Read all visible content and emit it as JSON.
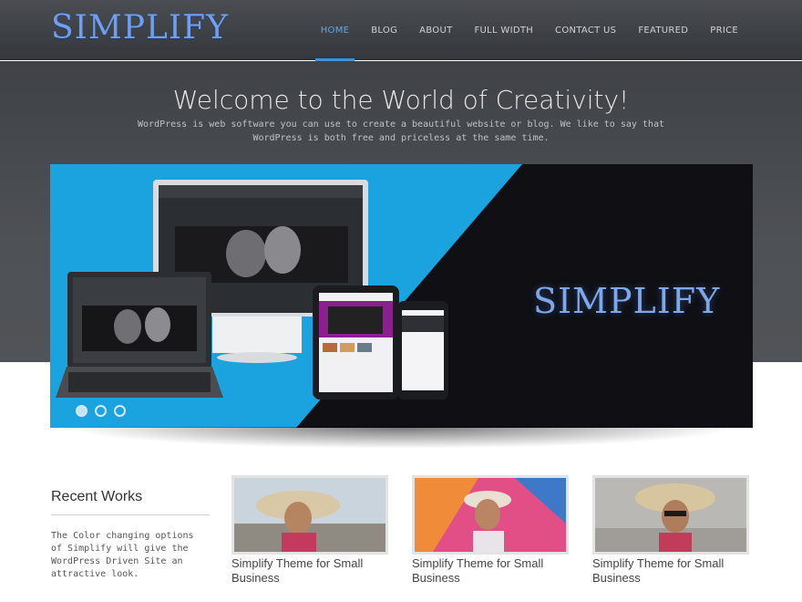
{
  "header": {
    "logo": "SIMPLIFY",
    "nav": [
      "HOME",
      "BLOG",
      "ABOUT",
      "FULL WIDTH",
      "CONTACT US",
      "FEATURED",
      "PRICE"
    ],
    "active_nav": "HOME"
  },
  "hero": {
    "title": "Welcome to the World of Creativity!",
    "subtitle": "WordPress is web software you can use to create a beautiful website or blog. We like to say that WordPress is both free and priceless at the same time."
  },
  "slider": {
    "slide_logo": "SIMPLIFY",
    "dots": 3,
    "active_dot": 1
  },
  "recent_works": {
    "title": "Recent Works",
    "description": "The Color changing options of Simplify will give the WordPress Driven Site an attractive look."
  },
  "works": [
    {
      "title": "Simplify Theme for Small Business",
      "image": "woman-beach-hat-photo"
    },
    {
      "title": "Simplify Theme for Small Business",
      "image": "woman-colorful-umbrella-photo"
    },
    {
      "title": "Simplify Theme for Small Business",
      "image": "woman-sunglasses-hat-photo"
    }
  ],
  "colors": {
    "accent": "#3b94df",
    "slider_blue": "#1ba3e0",
    "header_dark": "#3a3d41"
  }
}
